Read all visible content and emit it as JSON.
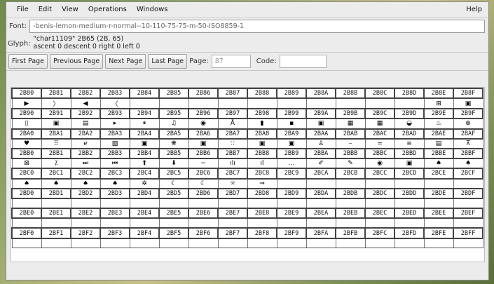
{
  "menu": {
    "file": "File",
    "edit": "Edit",
    "view": "View",
    "operations": "Operations",
    "windows": "Windows",
    "help": "Help"
  },
  "font": {
    "label": "Font:",
    "value": "-benis-lemon-medium-r-normal--10-110-75-75-m-50-ISO8859-1"
  },
  "glyph": {
    "label": "Glyph:",
    "line1": "\"char11109\" 2B65 (2B, 65)",
    "line2": "ascent 0 descent 0 right 0 left 0"
  },
  "nav": {
    "first": "First Page",
    "previous": "Previous Page",
    "next": "Next Page",
    "last": "Last Page",
    "page_label": "Page:",
    "page_value": "87",
    "code_label": "Code:",
    "code_value": ""
  },
  "grid": {
    "rows": [
      {
        "codes": [
          "2B80",
          "2B81",
          "2B82",
          "2B83",
          "2B84",
          "2B85",
          "2B86",
          "2B87",
          "2B88",
          "2B89",
          "2B8A",
          "2B8B",
          "2B8C",
          "2B8D",
          "2B8E",
          "2B8F"
        ],
        "glyphs": [
          "▶",
          "〉",
          "◀",
          "〈",
          "",
          "",
          "",
          "",
          "",
          "",
          "",
          "",
          "",
          "",
          "⊞",
          "▣"
        ]
      },
      {
        "codes": [
          "2B90",
          "2B91",
          "2B92",
          "2B93",
          "2B94",
          "2B95",
          "2B96",
          "2B97",
          "2B98",
          "2B99",
          "2B9A",
          "2B9B",
          "2B9C",
          "2B9D",
          "2B9E",
          "2B9F"
        ],
        "glyphs": [
          "▯",
          "▣",
          "▤",
          "▸",
          "⏸",
          "♫",
          "◉",
          "Å",
          "▮",
          "▪",
          "▣",
          "▦",
          "▦",
          "◒",
          "♨",
          "⊕"
        ]
      },
      {
        "codes": [
          "2BA0",
          "2BA1",
          "2BA2",
          "2BA3",
          "2BA4",
          "2BA5",
          "2BA6",
          "2BA7",
          "2BA8",
          "2BA9",
          "2BAA",
          "2BAB",
          "2BAC",
          "2BAD",
          "2BAE",
          "2BAF"
        ],
        "glyphs": [
          "♥",
          "⠿",
          "ℯ",
          "▧",
          "▣",
          "❋",
          "▣",
          "∷",
          "▣",
          "▣",
          "♙",
          "–",
          "=",
          "≡",
          "▤",
          "⊼"
        ]
      },
      {
        "codes": [
          "2BB0",
          "2BB1",
          "2BB2",
          "2BB3",
          "2BB4",
          "2BB5",
          "2BB6",
          "2BB7",
          "2BB8",
          "2BB9",
          "2BBA",
          "2BBB",
          "2BBC",
          "2BBD",
          "2BBE",
          "2BBF"
        ],
        "glyphs": [
          "⊠",
          "⁒",
          "⏭",
          "⏮",
          "⬆",
          "⬇",
          "−",
          "ılı",
          "ıl",
          "…",
          "✐",
          "✎",
          "◉",
          "▣",
          "♠",
          "♠"
        ]
      },
      {
        "codes": [
          "2BC0",
          "2BC1",
          "2BC2",
          "2BC3",
          "2BC4",
          "2BC5",
          "2BC6",
          "2BC7",
          "2BC8",
          "2BC9",
          "2BCA",
          "2BCB",
          "2BCC",
          "2BCD",
          "2BCE",
          "2BCF"
        ],
        "glyphs": [
          "♠",
          "♠",
          "♠",
          "♠",
          "✲",
          "☾",
          "☾",
          "☼",
          "⇒",
          "",
          "",
          "",
          "",
          "",
          "",
          ""
        ]
      },
      {
        "codes": [
          "2BD0",
          "2BD1",
          "2BD2",
          "2BD3",
          "2BD4",
          "2BD5",
          "2BD6",
          "2BD7",
          "2BD8",
          "2BD9",
          "2BDA",
          "2BDB",
          "2BDC",
          "2BDD",
          "2BDE",
          "2BDF"
        ],
        "glyphs": [
          "",
          "",
          "",
          "",
          "",
          "",
          "",
          "",
          "",
          "",
          "",
          "",
          "",
          "",
          "",
          ""
        ]
      },
      {
        "codes": [
          "2BE0",
          "2BE1",
          "2BE2",
          "2BE3",
          "2BE4",
          "2BE5",
          "2BE6",
          "2BE7",
          "2BE8",
          "2BE9",
          "2BEA",
          "2BEB",
          "2BEC",
          "2BED",
          "2BEE",
          "2BEF"
        ],
        "glyphs": [
          "",
          "",
          "",
          "",
          "",
          "",
          "",
          "",
          "",
          "",
          "",
          "",
          "",
          "",
          "",
          ""
        ]
      },
      {
        "codes": [
          "2BF0",
          "2BF1",
          "2BF2",
          "2BF3",
          "2BF4",
          "2BF5",
          "2BF6",
          "2BF7",
          "2BF8",
          "2BF9",
          "2BFA",
          "2BFB",
          "2BFC",
          "2BFD",
          "2BFE",
          "2BFF"
        ],
        "glyphs": [
          "",
          "",
          "",
          "",
          "",
          "",
          "",
          "",
          "",
          "",
          "",
          "",
          "",
          "",
          "",
          ""
        ]
      }
    ]
  }
}
